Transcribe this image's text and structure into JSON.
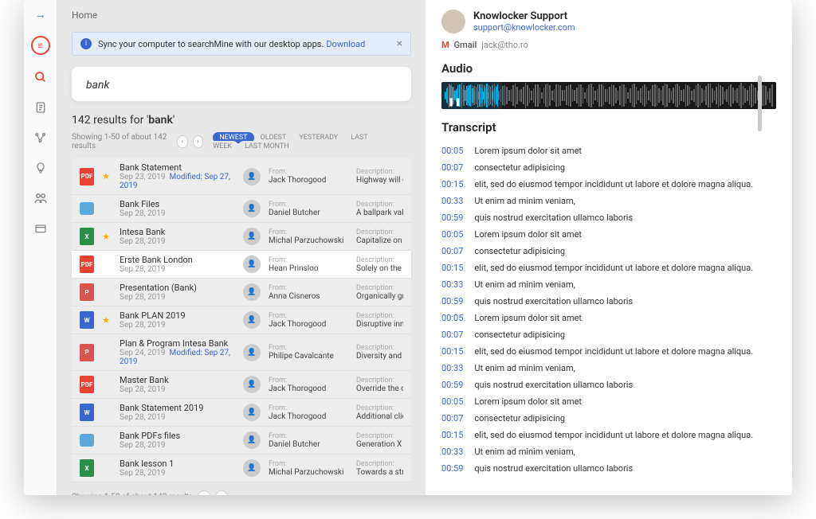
{
  "breadcrumb": "Home",
  "alert": {
    "text": "Sync your computer to searchMine with our desktop apps.",
    "link": "Download"
  },
  "search": {
    "value": "bank "
  },
  "results_header_count": "142",
  "results_header_term": "bank",
  "pagination_text": "Showing 1-50 of about 142 results",
  "filters": [
    "NEWEST",
    "OLDEST",
    "YESTERADY",
    "LAST WEEK",
    "LAST MONTH"
  ],
  "from_label": "From:",
  "desc_label": "Description:",
  "rows": [
    {
      "icon": "pdf",
      "star": true,
      "name": "Bank Statement",
      "date": "Sep 23, 2019",
      "mod": "Modified: Sep 27, 2019",
      "from": "Jack Thorogood",
      "desc": "Highway will close t"
    },
    {
      "icon": "folder",
      "star": false,
      "name": "Bank Files",
      "date": "Sep 28, 2019",
      "mod": "",
      "from": "Daniel Butcher",
      "desc": "A ballpark value ad"
    },
    {
      "icon": "xls",
      "star": true,
      "name": "Intesa Bank",
      "date": "Sep 28, 2019",
      "mod": "",
      "from": "Michal Parzuchowski",
      "desc": "Capitalize on low h"
    },
    {
      "icon": "pdf",
      "star": false,
      "name": "Erste Bank London",
      "date": "Sep 28, 2019",
      "mod": "",
      "from": "Hean Prinsloo",
      "desc": "Solely on the botto",
      "selected": true
    },
    {
      "icon": "ppt",
      "star": false,
      "name": "Presentation (Bank)",
      "date": "Sep 28, 2019",
      "mod": "",
      "from": "Anna Cisneros",
      "desc": "Organically grow th"
    },
    {
      "icon": "doc",
      "star": true,
      "name": "Bank PLAN 2019",
      "date": "Sep 28, 2019",
      "mod": "",
      "from": "Jack Thorogood",
      "desc": "Disruptive innovatic"
    },
    {
      "icon": "ppt",
      "star": false,
      "name": "Plan & Program Intesa Bank",
      "date": "Sep 24, 2019",
      "mod": "Modified: Sep 27, 2019",
      "from": "Philipe Cavalcante",
      "desc": "Diversity and empo"
    },
    {
      "icon": "pdf",
      "star": false,
      "name": "Master Bank",
      "date": "Sep 28, 2019",
      "mod": "",
      "from": "Jack Thorogood",
      "desc": "Override the digital"
    },
    {
      "icon": "doc",
      "star": false,
      "name": "Bank Statement 2019",
      "date": "Sep 28, 2019",
      "mod": "",
      "from": "Jack Thorogood",
      "desc": "Additional clickthro"
    },
    {
      "icon": "folder",
      "star": false,
      "name": "Bank PDFs files",
      "date": "Sep 28, 2019",
      "mod": "",
      "from": "Daniel Butcher",
      "desc": "Generation X is on"
    },
    {
      "icon": "xls",
      "star": false,
      "name": "Bank lesson 1",
      "date": "Sep 28, 2019",
      "mod": "",
      "from": "Michal Parzuchowski",
      "desc": "Towards a streamli"
    }
  ],
  "sender": {
    "name": "Knowlocker Support",
    "email": "support@knowlocker.com"
  },
  "gmail": {
    "label": "Gmail",
    "account": "jack@tho.ro"
  },
  "audio_title": "Audio",
  "transcript_title": "Transcript",
  "transcript": [
    {
      "t": "00:05",
      "txt": "Lorem ipsum dolor sit amet"
    },
    {
      "t": "00:07",
      "txt": "consectetur adipisicing"
    },
    {
      "t": "00:15",
      "txt": "elit, sed do eiusmod tempor incididunt ut labore et dolore magna aliqua."
    },
    {
      "t": "00:33",
      "txt": "Ut enim ad minim veniam,"
    },
    {
      "t": "00:59",
      "txt": "quis nostrud exercitation ullamco laboris"
    },
    {
      "t": "00:05",
      "txt": "Lorem ipsum dolor sit amet"
    },
    {
      "t": "00:07",
      "txt": "consectetur adipisicing"
    },
    {
      "t": "00:15",
      "txt": "elit, sed do eiusmod tempor incididunt ut labore et dolore magna aliqua."
    },
    {
      "t": "00:33",
      "txt": "Ut enim ad minim veniam,"
    },
    {
      "t": "00:59",
      "txt": "quis nostrud exercitation ullamco laboris"
    },
    {
      "t": "00:05",
      "txt": "Lorem ipsum dolor sit amet"
    },
    {
      "t": "00:07",
      "txt": "consectetur adipisicing"
    },
    {
      "t": "00:15",
      "txt": "elit, sed do eiusmod tempor incididunt ut labore et dolore magna aliqua."
    },
    {
      "t": "00:33",
      "txt": "Ut enim ad minim veniam,"
    },
    {
      "t": "00:59",
      "txt": "quis nostrud exercitation ullamco laboris"
    },
    {
      "t": "00:05",
      "txt": "Lorem ipsum dolor sit amet"
    },
    {
      "t": "00:07",
      "txt": "consectetur adipisicing"
    },
    {
      "t": "00:15",
      "txt": "elit, sed do eiusmod tempor incididunt ut labore et dolore magna aliqua."
    },
    {
      "t": "00:33",
      "txt": "Ut enim ad minim veniam,"
    },
    {
      "t": "00:59",
      "txt": "quis nostrud exercitation ullamco laboris"
    }
  ]
}
